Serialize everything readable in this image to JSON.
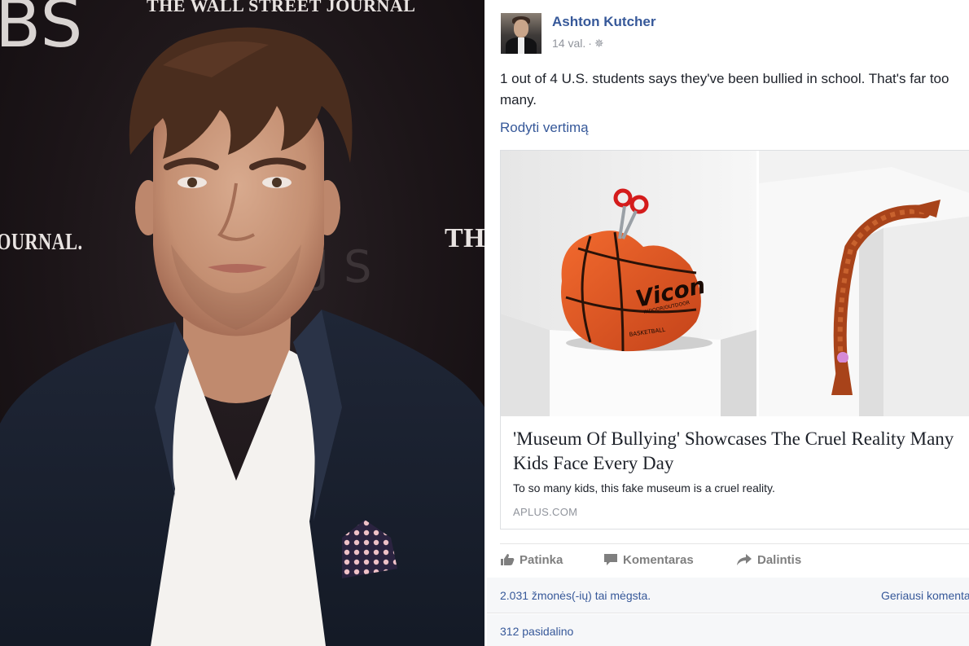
{
  "photo": {
    "backdrop_texts": {
      "bs": "BS",
      "wsj": "THE WALL STREET JOURNAL",
      "journal": "OURNAL.",
      "the": "THE",
      "ghost": "J S"
    }
  },
  "post": {
    "author": "Ashton Kutcher",
    "time": "14 val.",
    "separator": "·",
    "audience_icon": "globe-icon",
    "text_line_1": "1 out of 4 U.S. students says they've been bullied in school. That's far too",
    "text_line_2": "many.",
    "translate_label": "Rodyti vertimą"
  },
  "link_preview": {
    "title": "'Museum Of Bullying' Showcases The Cruel Reality Many Kids Face Every Day",
    "description": "To so many kids, this fake museum is a cruel reality.",
    "source": "APLUS.COM",
    "ball_brand": "Vicon",
    "ball_subtext": "INDOOR/OUTDOOR",
    "ball_subtext_2": "BASKETBALL"
  },
  "actions": {
    "like_label": "Patinka",
    "comment_label": "Komentaras",
    "share_label": "Dalintis"
  },
  "stats": {
    "likes": "2.031 žmonės(-ių) tai mėgsta.",
    "top_comments": "Geriausi komentarai",
    "shares": "312 pasidalino"
  },
  "colors": {
    "link_blue": "#365899",
    "meta_gray": "#90949c",
    "action_gray": "#7f7f7f",
    "stats_bg": "#f6f7f9"
  }
}
